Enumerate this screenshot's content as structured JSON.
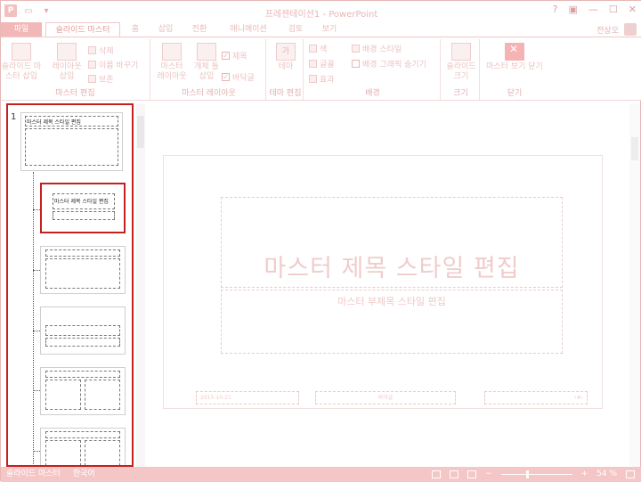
{
  "window": {
    "title": "프레젠테이션1 - PowerPoint",
    "controls": [
      "?",
      "▣",
      "—",
      "☐",
      "✕"
    ]
  },
  "qat": {
    "app_icon": "P"
  },
  "tabs": [
    "파일",
    "슬라이드 마스터",
    "홈",
    "삽입",
    "전환",
    "애니메이션",
    "검토",
    "보기"
  ],
  "user": {
    "name": "전상오"
  },
  "ribbon": {
    "group_master_edit": {
      "label": "마스터 편집",
      "insert_master": "슬라이드 마\n스터 삽입",
      "insert_layout": "레이아웃\n삽입",
      "delete": "삭제",
      "rename": "이름 바꾸기",
      "preserve": "보존"
    },
    "group_master_layout": {
      "label": "마스터 레이아웃",
      "master_layout": "마스터\n레이아웃",
      "insert_placeholder": "개체 틀\n삽입",
      "title_check": "제목",
      "footer_check": "바닥글"
    },
    "group_theme": {
      "label": "테마 편집",
      "themes": "테마",
      "themes_icon_text": "가"
    },
    "group_background": {
      "label": "배경",
      "colors": "색",
      "fonts": "글꼴",
      "effects": "효과",
      "bg_styles": "배경 스타일",
      "hide_bg": "배경 그래픽 숨기기"
    },
    "group_size": {
      "label": "크기",
      "slide_size": "슬라이드\n크기"
    },
    "group_close": {
      "label": "닫기",
      "close_master": "마스터 보기 닫기"
    }
  },
  "thumbnails": {
    "slide_number": "1",
    "master_title": "마스터 제목 스타일 편집",
    "layout_title": "마스터 제목 스타일 편집"
  },
  "slide": {
    "title_placeholder": "마스터 제목 스타일 편집",
    "subtitle_placeholder": "마스터 부제목 스타일 편집",
    "footer_date": "2015-10-21",
    "footer_text": "바닥글",
    "footer_num": "‹#›"
  },
  "statusbar": {
    "view_name": "슬라이드 마스터",
    "language": "한국어",
    "zoom": "54 %"
  },
  "colors": {
    "accent": "#f2b8b8",
    "selection": "#c42020"
  }
}
